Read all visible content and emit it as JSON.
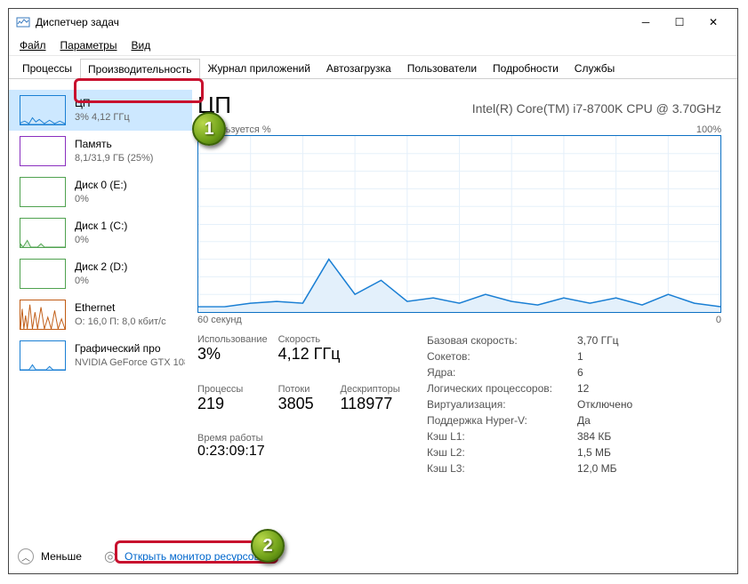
{
  "window": {
    "title": "Диспетчер задач"
  },
  "menu": {
    "file": "Файл",
    "options": "Параметры",
    "view": "Вид"
  },
  "tabs": {
    "processes": "Процессы",
    "performance": "Производительность",
    "app_history": "Журнал приложений",
    "startup": "Автозагрузка",
    "users": "Пользователи",
    "details": "Подробности",
    "services": "Службы"
  },
  "sidebar": {
    "cpu": {
      "name": "ЦП",
      "sub": "3% 4,12 ГГц",
      "color": "#1a7fd4"
    },
    "memory": {
      "name": "Память",
      "sub": "8,1/31,9 ГБ (25%)",
      "color": "#8a2fbf"
    },
    "disk0": {
      "name": "Диск 0 (E:)",
      "sub": "0%",
      "color": "#4fa24f"
    },
    "disk1": {
      "name": "Диск 1 (C:)",
      "sub": "0%",
      "color": "#4fa24f"
    },
    "disk2": {
      "name": "Диск 2 (D:)",
      "sub": "0%",
      "color": "#4fa24f"
    },
    "ethernet": {
      "name": "Ethernet",
      "sub": "О: 16,0 П: 8,0 кбит/с",
      "color": "#c05b13"
    },
    "gpu": {
      "name": "Графический про",
      "sub": "NVIDIA GeForce GTX 108",
      "color": "#1a7fd4"
    }
  },
  "main": {
    "title": "ЦП",
    "model": "Intel(R) Core(TM) i7-8700K CPU @ 3.70GHz",
    "chart_top_left": "Используется %",
    "chart_top_right": "100%",
    "chart_bottom_left": "60 секунд",
    "chart_bottom_right": "0",
    "stat_labels": {
      "usage": "Использование",
      "speed": "Скорость",
      "processes": "Процессы",
      "threads": "Потоки",
      "handles": "Дескрипторы",
      "uptime": "Время работы"
    },
    "stat_values": {
      "usage": "3%",
      "speed": "4,12 ГГц",
      "processes": "219",
      "threads": "3805",
      "handles": "118977",
      "uptime": "0:23:09:17"
    },
    "info": {
      "base_speed_k": "Базовая скорость:",
      "base_speed_v": "3,70 ГГц",
      "sockets_k": "Сокетов:",
      "sockets_v": "1",
      "cores_k": "Ядра:",
      "cores_v": "6",
      "logical_k": "Логических процессоров:",
      "logical_v": "12",
      "virt_k": "Виртуализация:",
      "virt_v": "Отключено",
      "hyperv_k": "Поддержка Hyper-V:",
      "hyperv_v": "Да",
      "l1_k": "Кэш L1:",
      "l1_v": "384 КБ",
      "l2_k": "Кэш L2:",
      "l2_v": "1,5 МБ",
      "l3_k": "Кэш L3:",
      "l3_v": "12,0 МБ"
    }
  },
  "footer": {
    "less": "Меньше",
    "open_resmon": "Открыть монитор ресурсов"
  },
  "chart_data": {
    "type": "line",
    "title": "Используется %",
    "xlabel": "60 секунд",
    "ylabel": "%",
    "ylim": [
      0,
      100
    ],
    "x_seconds_ago": [
      60,
      57,
      54,
      51,
      48,
      45,
      42,
      39,
      36,
      33,
      30,
      27,
      24,
      21,
      18,
      15,
      12,
      9,
      6,
      3,
      0
    ],
    "values": [
      3,
      3,
      5,
      6,
      5,
      30,
      10,
      18,
      6,
      8,
      5,
      10,
      6,
      4,
      8,
      5,
      8,
      4,
      10,
      5,
      3
    ]
  },
  "badges": {
    "one": "1",
    "two": "2"
  }
}
